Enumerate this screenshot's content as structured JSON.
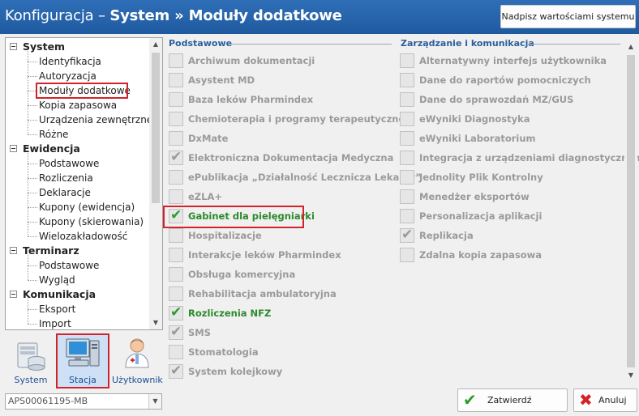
{
  "window": {
    "title_prefix": "Konfiguracja – ",
    "title_main": "System » Moduły dodatkowe",
    "override_button": "Nadpisz wartościami systemu"
  },
  "tree": {
    "groups": [
      {
        "label": "System",
        "items": [
          "Identyfikacja",
          "Autoryzacja",
          "Moduły dodatkowe",
          "Kopia zapasowa",
          "Urządzenia zewnętrzne",
          "Różne"
        ]
      },
      {
        "label": "Ewidencja",
        "items": [
          "Podstawowe",
          "Rozliczenia",
          "Deklaracje",
          "Kupony (ewidencja)",
          "Kupony (skierowania)",
          "Wielozakładowość"
        ]
      },
      {
        "label": "Terminarz",
        "items": [
          "Podstawowe",
          "Wygląd"
        ]
      },
      {
        "label": "Komunikacja",
        "items": [
          "Eksport",
          "Import"
        ]
      }
    ],
    "selected": "Moduły dodatkowe"
  },
  "scope_selector": {
    "system_label": "System",
    "station_label": "Stacja",
    "user_label": "Użytkownik",
    "active": "Stacja"
  },
  "station_combo": {
    "value": "APS00061195-MB"
  },
  "modules": {
    "left_header": "Podstawowe",
    "right_header": "Zarządzanie i komunikacja",
    "left": [
      {
        "label": "Archiwum dokumentacji",
        "checked": false,
        "active": false
      },
      {
        "label": "Asystent MD",
        "checked": false,
        "active": false
      },
      {
        "label": "Baza leków Pharmindex",
        "checked": false,
        "active": false
      },
      {
        "label": "Chemioterapia i programy terapeutyczne",
        "checked": false,
        "active": false
      },
      {
        "label": "DxMate",
        "checked": false,
        "active": false
      },
      {
        "label": "Elektroniczna Dokumentacja Medyczna",
        "checked": true,
        "active": false
      },
      {
        "label": "ePublikacja „Działalność Lecznicza Lekarzy”",
        "checked": false,
        "active": false
      },
      {
        "label": "eZLA+",
        "checked": false,
        "active": false
      },
      {
        "label": "Gabinet dla pielęgniarki",
        "checked": true,
        "active": true
      },
      {
        "label": "Hospitalizacje",
        "checked": false,
        "active": false
      },
      {
        "label": "Interakcje leków Pharmindex",
        "checked": false,
        "active": false
      },
      {
        "label": "Obsługa komercyjna",
        "checked": false,
        "active": false
      },
      {
        "label": "Rehabilitacja ambulatoryjna",
        "checked": false,
        "active": false
      },
      {
        "label": "Rozliczenia NFZ",
        "checked": true,
        "active": true
      },
      {
        "label": "SMS",
        "checked": true,
        "active": false
      },
      {
        "label": "Stomatologia",
        "checked": false,
        "active": false
      },
      {
        "label": "System kolejkowy",
        "checked": true,
        "active": false
      }
    ],
    "right": [
      {
        "label": "Alternatywny interfejs użytkownika",
        "checked": false,
        "active": false
      },
      {
        "label": "Dane do raportów pomocniczych",
        "checked": false,
        "active": false
      },
      {
        "label": "Dane do sprawozdań MZ/GUS",
        "checked": false,
        "active": false
      },
      {
        "label": "eWyniki Diagnostyka",
        "checked": false,
        "active": false
      },
      {
        "label": "eWyniki Laboratorium",
        "checked": false,
        "active": false
      },
      {
        "label": "Integracja z urządzeniami diagnostycznymi",
        "checked": false,
        "active": false
      },
      {
        "label": "Jednolity Plik Kontrolny",
        "checked": false,
        "active": false
      },
      {
        "label": "Menedżer eksportów",
        "checked": false,
        "active": false
      },
      {
        "label": "Personalizacja aplikacji",
        "checked": false,
        "active": false
      },
      {
        "label": "Replikacja",
        "checked": true,
        "active": false
      },
      {
        "label": "Zdalna kopia zapasowa",
        "checked": false,
        "active": false
      }
    ]
  },
  "buttons": {
    "confirm": "Zatwierdź",
    "cancel": "Anuluj"
  },
  "colors": {
    "title_bar": "#2367ae",
    "active_label": "#2b8a2b",
    "inactive_label": "#9a9a9a",
    "highlight": "#d2232a",
    "section_header": "#2c5f9c"
  }
}
